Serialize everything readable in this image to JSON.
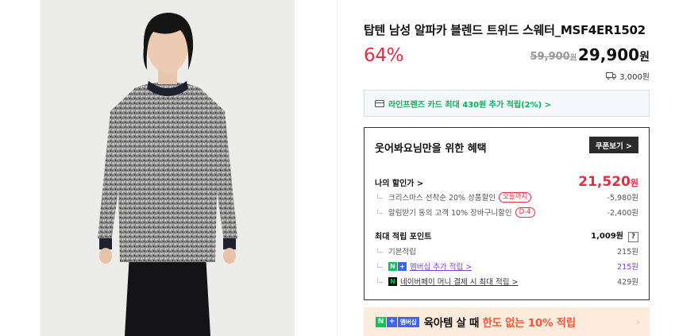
{
  "product": {
    "title": "탑텐 남성 알파카 블렌드 트위드 스웨터_MSF4ER1502",
    "discount": "64%",
    "original_price": "59,900",
    "original_unit": "원",
    "sale_price": "29,900",
    "sale_unit": "원",
    "delivery_fee": "3,000원"
  },
  "card_promo": {
    "text": "라인프렌즈 카드 최대 430원 추가 적립(2%) >"
  },
  "benefit": {
    "title": "웃어봐요님만을 위한 혜택",
    "coupon_button": "쿠폰보기 >",
    "my_discount_label": "나의 할인가 >",
    "my_discount_value": "21,520",
    "my_discount_unit": "원",
    "discounts": [
      {
        "label": "크리스마스 선착순 20% 상품할인",
        "tag": "오늘까지",
        "value": "-5,980원"
      },
      {
        "label": "알림받기 동의 고객 10% 장바구니할인",
        "tag": "D-4",
        "value": "-2,400원"
      }
    ],
    "points_label": "최대 적립 포인트",
    "points_value": "1,009원",
    "points_help": "?",
    "points": [
      {
        "label": "기본적립",
        "value": "215원"
      },
      {
        "label": "멤버십 추가 적립 >",
        "value": "215원"
      },
      {
        "label": "네이버페이 머니 결제 시 최대 적립 >",
        "value": "429원"
      }
    ]
  },
  "banner": {
    "badge_n": "N",
    "badge_plus": "+",
    "badge_membership": "멤버십",
    "text_main": "육아템 살 때 ",
    "text_highlight": "한도 없는 10% 적립",
    "arrow": "›"
  },
  "icons": {
    "delivery": "truck-icon",
    "card": "card-icon",
    "naver_plus": "naver-plus-membership-icon",
    "naver_pay": "naver-pay-icon"
  },
  "colors": {
    "accent_red": "#e42c43",
    "naver_green": "#03c75a",
    "membership_blue": "#3f64f0",
    "membership_purple": "#7b44d6",
    "banner_bg": "#fdecdc"
  }
}
